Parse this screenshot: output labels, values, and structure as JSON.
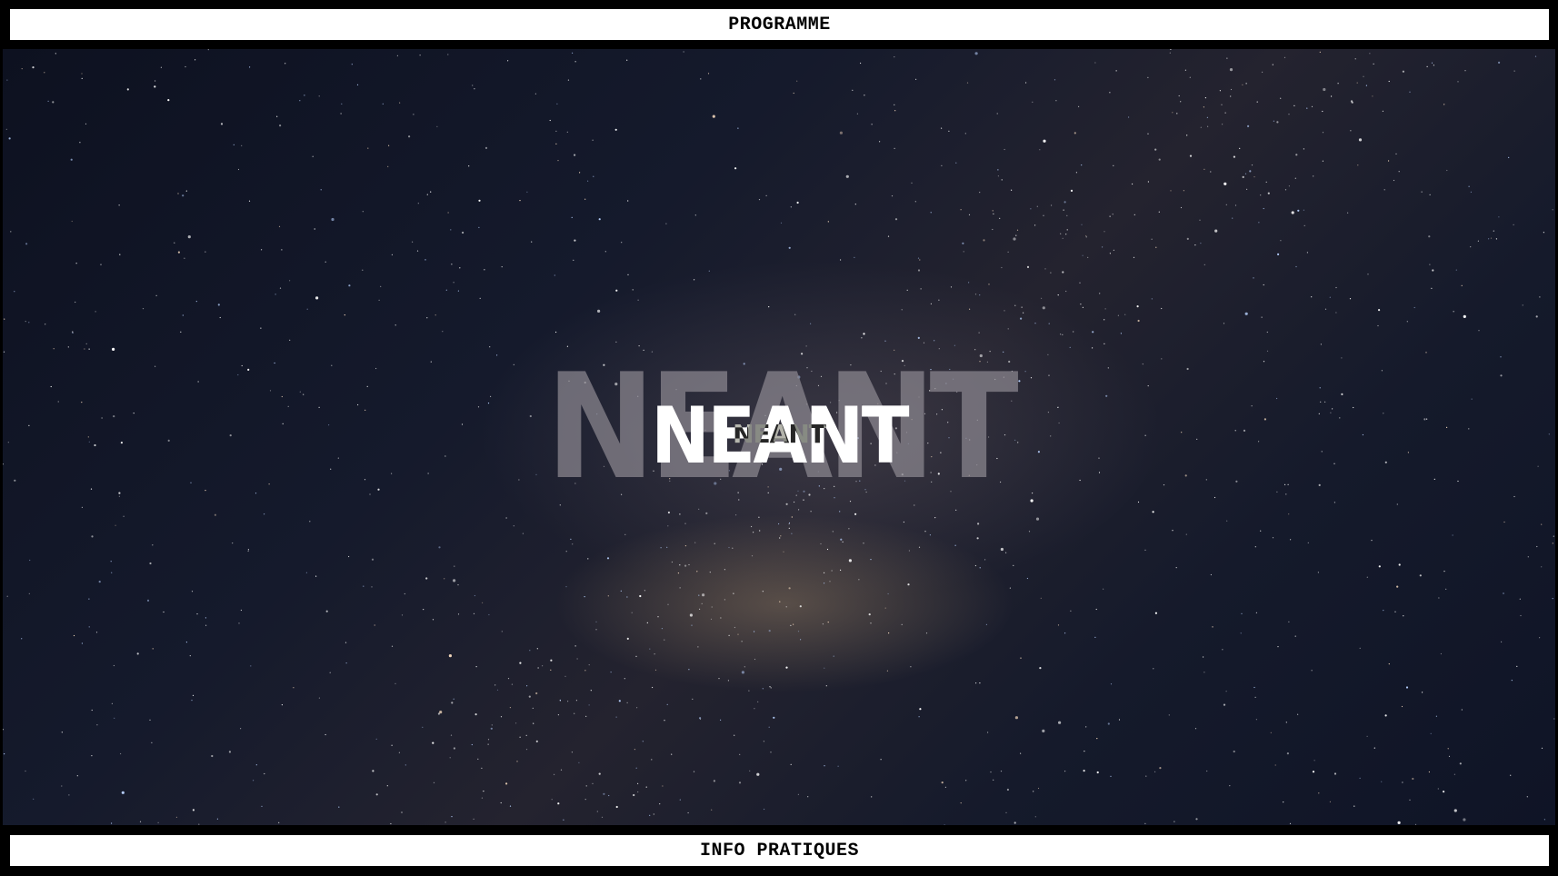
{
  "nav": {
    "top_label": "PROGRAMME",
    "bottom_label": "INFO PRATIQUES"
  },
  "hero": {
    "title_back": "NEANT",
    "title_front": "NEANT",
    "title_small": "NEANT",
    "background": "starry-night-sky-milky-way"
  },
  "colors": {
    "page_border": "#000000",
    "nav_background": "#ffffff",
    "nav_text": "#000000",
    "title_text": "#ffffff"
  }
}
